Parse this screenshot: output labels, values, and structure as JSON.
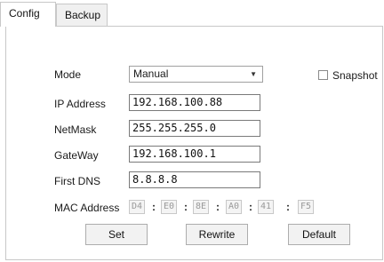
{
  "tabs": [
    {
      "label": "Config",
      "active": true
    },
    {
      "label": "Backup",
      "active": false
    }
  ],
  "form": {
    "mode_label": "Mode",
    "mode_value": "Manual",
    "snapshot_label": "Snapshot",
    "snapshot_checked": false,
    "ip_label": "IP Address",
    "ip_value": "192.168.100.88",
    "netmask_label": "NetMask",
    "netmask_value": "255.255.255.0",
    "gateway_label": "GateWay",
    "gateway_value": "192.168.100.1",
    "dns_label": "First DNS",
    "dns_value": "8.8.8.8",
    "mac_label": "MAC Address",
    "mac_octets": [
      "D4",
      "E0",
      "8E",
      "A0",
      "41",
      "F5"
    ],
    "mac_separator": ":"
  },
  "buttons": {
    "set": "Set",
    "rewrite": "Rewrite",
    "default": "Default"
  },
  "icons": {
    "select_arrow": "chevron-down-icon"
  },
  "colors": {
    "border": "#c8c8c8",
    "input_border": "#7a7a7a",
    "button_bg": "#f2f2f2",
    "disabled_text": "#999999"
  }
}
